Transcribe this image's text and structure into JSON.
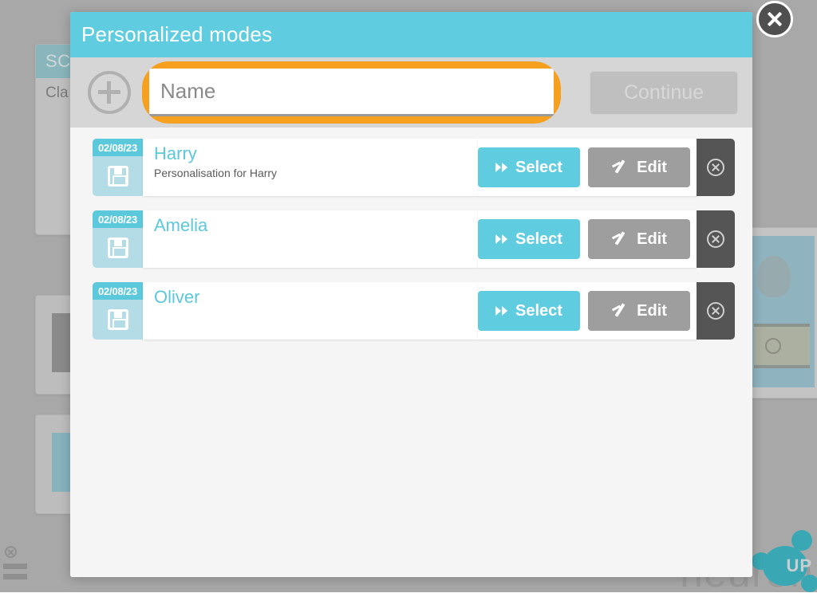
{
  "modal": {
    "title": "Personalized modes",
    "close_label": "Close",
    "toolbar": {
      "add_label": "Add",
      "name_placeholder": "Name",
      "name_value": "",
      "continue_label": "Continue"
    },
    "rows": [
      {
        "date": "02/08/23",
        "title": "Harry",
        "subtitle": "Personalisation for Harry",
        "select_label": "Select",
        "edit_label": "Edit",
        "delete_label": "Delete"
      },
      {
        "date": "02/08/23",
        "title": "Amelia",
        "subtitle": "",
        "select_label": "Select",
        "edit_label": "Edit",
        "delete_label": "Delete"
      },
      {
        "date": "02/08/23",
        "title": "Oliver",
        "subtitle": "",
        "select_label": "Select",
        "edit_label": "Edit",
        "delete_label": "Delete"
      }
    ]
  },
  "background": {
    "card_1_title": "SC",
    "card_1_sub": "Cla",
    "brand_name": "neuron",
    "brand_suffix": "UP"
  },
  "colors": {
    "accent_cyan": "#5FCCE0",
    "highlight_orange": "#F5A01E",
    "edit_gray": "#9E9E9E",
    "delete_dark": "#555555",
    "badge_light": "#B3DCE6"
  }
}
